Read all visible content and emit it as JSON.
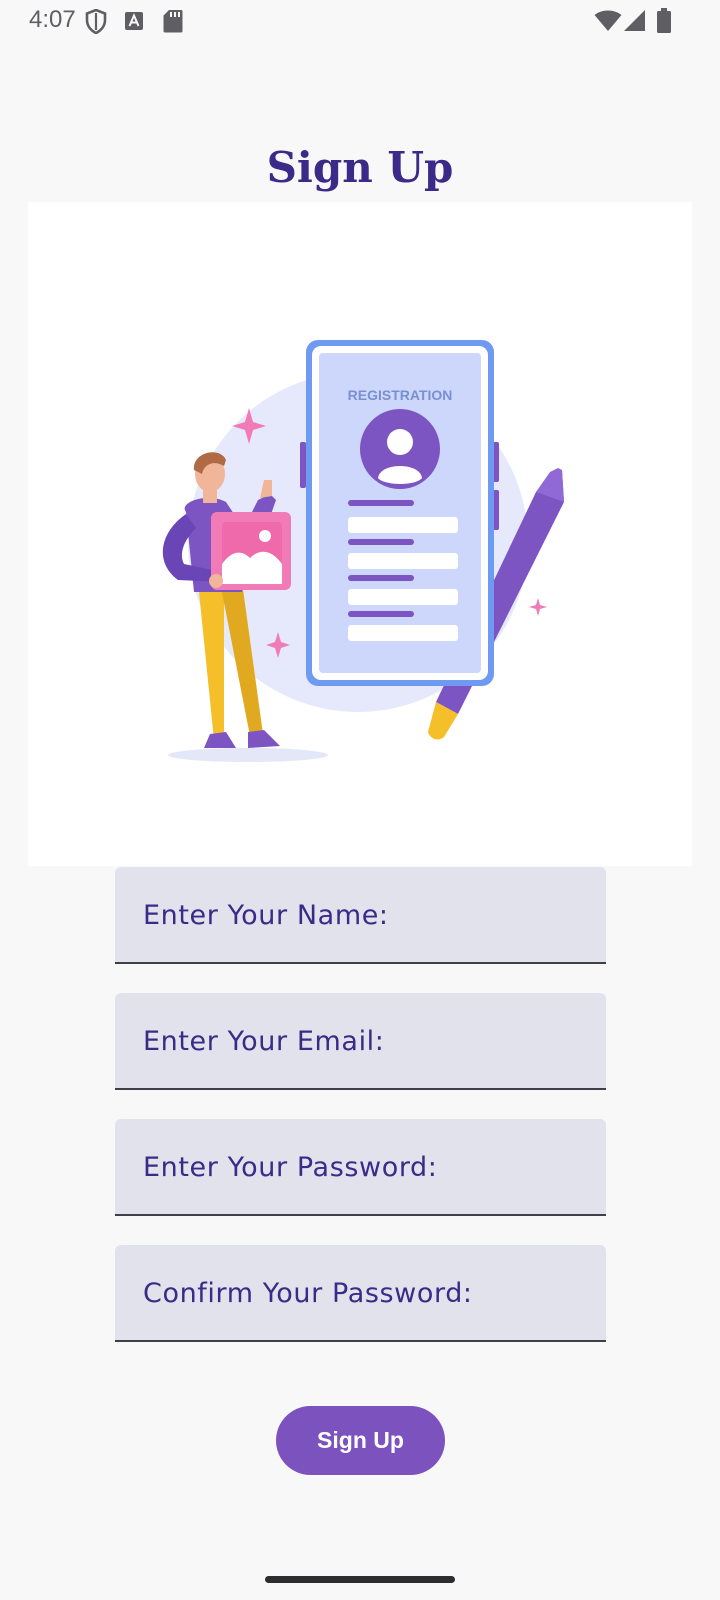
{
  "status_bar": {
    "time": "4:07",
    "icons": [
      "shield-icon",
      "a-box-icon",
      "sd-card-icon",
      "wifi-icon",
      "signal-icon",
      "battery-icon"
    ]
  },
  "title": "Sign Up",
  "illustration": {
    "phone_heading": "REGISTRATION"
  },
  "form": {
    "name_label": "Enter Your Name:",
    "email_label": "Enter Your Email:",
    "password_label": "Enter Your Password:",
    "confirm_label": "Confirm Your Password:"
  },
  "button": {
    "signup_label": "Sign Up"
  },
  "colors": {
    "accent": "#7b52be",
    "title": "#3b2a87",
    "field_bg": "#e2e2ec"
  }
}
